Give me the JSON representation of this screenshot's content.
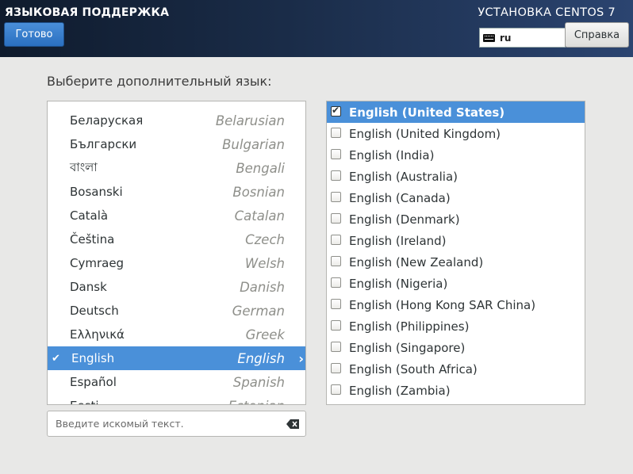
{
  "header": {
    "title": "ЯЗЫКОВАЯ ПОДДЕРЖКА",
    "done_label": "Готово",
    "product": "УСТАНОВКА CENTOS 7",
    "keyboard_layout": "ru",
    "help_label": "Справка"
  },
  "prompt": "Выберите дополнительный язык:",
  "languages": [
    {
      "native": "Беларуская",
      "english": "Belarusian"
    },
    {
      "native": "Български",
      "english": "Bulgarian"
    },
    {
      "native": "বাংলা",
      "english": "Bengali"
    },
    {
      "native": "Bosanski",
      "english": "Bosnian"
    },
    {
      "native": "Català",
      "english": "Catalan"
    },
    {
      "native": "Čeština",
      "english": "Czech"
    },
    {
      "native": "Cymraeg",
      "english": "Welsh"
    },
    {
      "native": "Dansk",
      "english": "Danish"
    },
    {
      "native": "Deutsch",
      "english": "German"
    },
    {
      "native": "Ελληνικά",
      "english": "Greek"
    },
    {
      "native": "English",
      "english": "English",
      "selected": true
    },
    {
      "native": "Español",
      "english": "Spanish"
    },
    {
      "native": "Eesti",
      "english": "Estonian"
    }
  ],
  "search": {
    "placeholder": "Введите искомый текст."
  },
  "locales": [
    {
      "label": "English (United States)",
      "checked": true
    },
    {
      "label": "English (United Kingdom)",
      "checked": false
    },
    {
      "label": "English (India)",
      "checked": false
    },
    {
      "label": "English (Australia)",
      "checked": false
    },
    {
      "label": "English (Canada)",
      "checked": false
    },
    {
      "label": "English (Denmark)",
      "checked": false
    },
    {
      "label": "English (Ireland)",
      "checked": false
    },
    {
      "label": "English (New Zealand)",
      "checked": false
    },
    {
      "label": "English (Nigeria)",
      "checked": false
    },
    {
      "label": "English (Hong Kong SAR China)",
      "checked": false
    },
    {
      "label": "English (Philippines)",
      "checked": false
    },
    {
      "label": "English (Singapore)",
      "checked": false
    },
    {
      "label": "English (South Africa)",
      "checked": false
    },
    {
      "label": "English (Zambia)",
      "checked": false
    }
  ],
  "colors": {
    "accent": "#4a90d9",
    "header_dark": "#0f1b2d"
  },
  "icons": {
    "done_check": "checkmark-icon",
    "expand": "chevron-right-icon",
    "clear": "backspace-icon",
    "keyboard": "keyboard-icon"
  }
}
